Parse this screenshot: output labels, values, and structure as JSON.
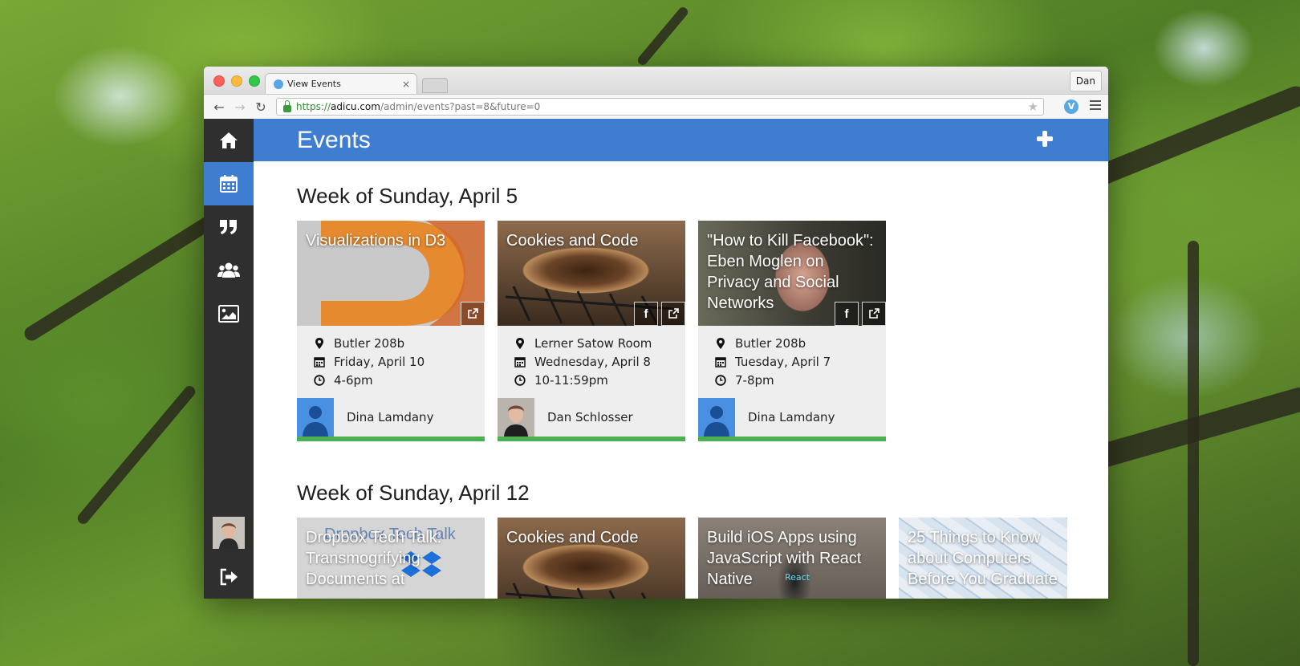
{
  "browser": {
    "tab_title": "View Events",
    "tab_close": "×",
    "profile": "Dan",
    "url": {
      "scheme": "https://",
      "host": "adicu.com",
      "path": "/admin/events?past=8&future=0"
    }
  },
  "sidebar": {
    "items": [
      {
        "name": "home",
        "icon": "home-icon"
      },
      {
        "name": "events",
        "icon": "calendar-icon",
        "active": true
      },
      {
        "name": "quotes",
        "icon": "quote-icon"
      },
      {
        "name": "people",
        "icon": "users-icon"
      },
      {
        "name": "media",
        "icon": "image-icon"
      }
    ],
    "bottom": [
      {
        "name": "profile",
        "icon": "avatar"
      },
      {
        "name": "logout",
        "icon": "sign-out-icon"
      }
    ]
  },
  "header": {
    "title": "Events",
    "add_icon": "plus-icon"
  },
  "weeks": [
    {
      "title": "Week of Sunday, April 5",
      "events": [
        {
          "title": "Visualizations in D3",
          "location": "Butler 208b",
          "date": "Friday, April 10",
          "time": "4-6pm",
          "host": "Dina Lamdany",
          "facebook": false
        },
        {
          "title": "Cookies and Code",
          "location": "Lerner Satow Room",
          "date": "Wednesday, April 8",
          "time": "10-11:59pm",
          "host": "Dan Schlosser",
          "facebook": true
        },
        {
          "title": "\"How to Kill Facebook\": Eben Moglen on Privacy and Social Networks",
          "location": "Butler 208b",
          "date": "Tuesday, April 7",
          "time": "7-8pm",
          "host": "Dina Lamdany",
          "facebook": true
        }
      ]
    },
    {
      "title": "Week of Sunday, April 12",
      "events": [
        {
          "title": "Dropbox Tech Talk: Transmogrifying Documents at"
        },
        {
          "title": "Cookies and Code"
        },
        {
          "title": "Build iOS Apps using JavaScript with React Native"
        },
        {
          "title": "25 Things to Know about Computers Before You Graduate"
        }
      ]
    }
  ],
  "colors": {
    "accent": "#3f7dd0",
    "sidebar": "#2f2f2f",
    "status_bar": "#4caf50",
    "card": "#eeeeee"
  },
  "image_text": {
    "d3_logo": "D3",
    "dropbox_overlay": "Dropbox Tech Talk",
    "react_phone": "React"
  }
}
